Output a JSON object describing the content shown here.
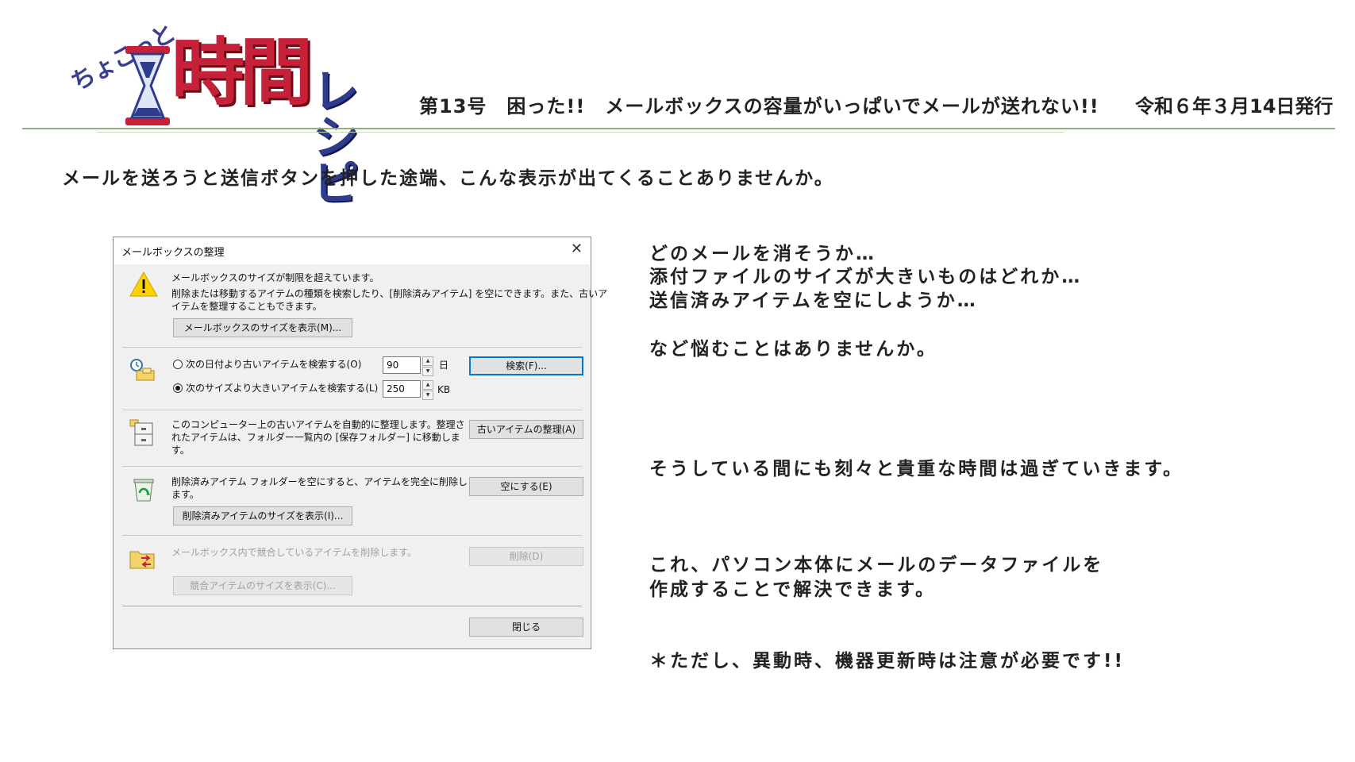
{
  "header": {
    "logo_small": "ちょこっと",
    "logo_big": "時間",
    "logo_rest": "レシピ",
    "issue_title": "第13号　困った!!　メールボックスの容量がいっぱいでメールが送れない!!",
    "issue_date": "令和６年３月14日発行"
  },
  "lead": "メールを送ろうと送信ボタンを押した途端、こんな表示が出てくることありませんか。",
  "dialog": {
    "title": "メールボックスの整理",
    "warning_title": "メールボックスのサイズが制限を超えています。",
    "warning_body_1": "削除または移動するアイテムの種類を検索したり、[削除済みアイテム] を空にできます。また、古いア",
    "warning_body_2": "イテムを整理することもできます。",
    "view_size_button": "メールボックスのサイズを表示(M)...",
    "radio_date_label": "次の日付より古いアイテムを検索する(O)",
    "radio_date_value": "90",
    "radio_date_unit": "日",
    "radio_size_label": "次のサイズより大きいアイテムを検索する(L)",
    "radio_size_value": "250",
    "radio_size_unit": "KB",
    "search_button": "検索(F)...",
    "archive_text_1": "このコンピューター上の古いアイテムを自動的に整理します。整理さ",
    "archive_text_2": "れたアイテムは、フォルダー一覧内の [保存フォルダー] に移動しま",
    "archive_text_3": "す。",
    "archive_button": "古いアイテムの整理(A)",
    "deleted_text_1": "削除済みアイテム フォルダーを空にすると、アイテムを完全に削除し",
    "deleted_text_2": "ます。",
    "empty_button": "空にする(E)",
    "deleted_size_button": "削除済みアイテムのサイズを表示(I)...",
    "conflict_text": "メールボックス内で競合しているアイテムを削除します。",
    "delete_button": "削除(D)",
    "conflict_size_button": "競合アイテムのサイズを表示(C)...",
    "close_button": "閉じる"
  },
  "right_text": {
    "line1": "どのメールを消そうか…",
    "line2": "添付ファイルのサイズが大きいものはどれか…",
    "line3": "送信済みアイテムを空にしようか…",
    "line4": "など悩むことはありませんか。",
    "line5": "そうしている間にも刻々と貴重な時間は過ぎていきます。",
    "line6": "これ、パソコン本体にメールのデータファイルを",
    "line7": "作成することで解決できます。",
    "line8": "＊ただし、異動時、機器更新時は注意が必要です!!"
  },
  "colors": {
    "logo_red": "#c7213a",
    "logo_blue": "#2e3c8e",
    "rule_green": "#8fb27c"
  }
}
